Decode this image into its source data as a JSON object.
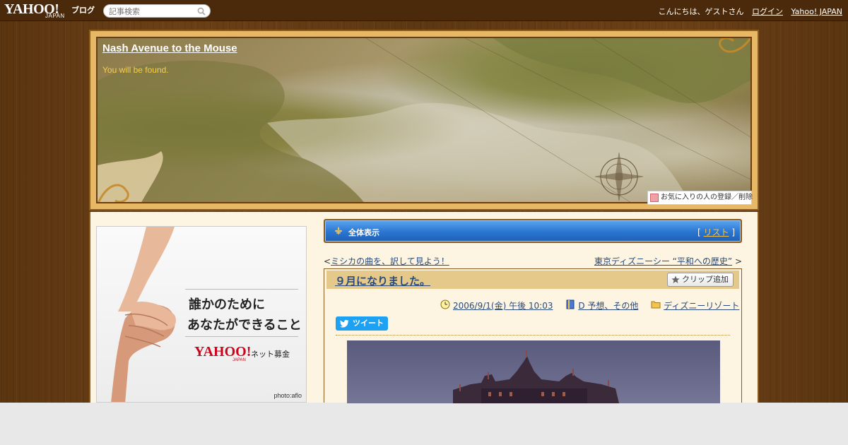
{
  "topbar": {
    "logo_text": "YAHOO!",
    "logo_sub": "JAPAN",
    "logo_service": "ブログ",
    "search_placeholder": "記事検索",
    "greeting": "こんにちは、ゲストさん",
    "login_label": "ログイン",
    "yahoo_japan_label": "Yahoo! JAPAN"
  },
  "banner": {
    "title": "Nash Avenue to the Mouse",
    "tagline": "You will be found.",
    "favorite_button": "お気に入りの人の登録／削除"
  },
  "ad": {
    "line1": "誰かのために",
    "line2": "あなたができること",
    "brand": "YAHOO!",
    "brand_sub": "JAPAN",
    "service": "ネット募金",
    "credit": "photo:aflo"
  },
  "nav": {
    "title": "全体表示",
    "list_open": "[",
    "list_label": "リスト",
    "list_close": "]"
  },
  "pager": {
    "prev_arrow": "<",
    "prev_label": "ミシカの曲を、訳して見よう！",
    "next_label": "東京ディズニーシー “平和への歴史”",
    "next_arrow": ">"
  },
  "article": {
    "title": "９月になりました。",
    "clip_label": "クリップ追加",
    "date": "2006/9/1(金) 午後 10:03",
    "category": "D 予想、その他",
    "folder": "ディズニーリゾート",
    "tweet_label": "ツイート"
  },
  "colors": {
    "topbar": "#4a2a0a",
    "nav_blue": "#2a76d0",
    "link": "#2a4a7a",
    "tagline": "#f6d04a",
    "content_bg": "#fdf5e2"
  }
}
